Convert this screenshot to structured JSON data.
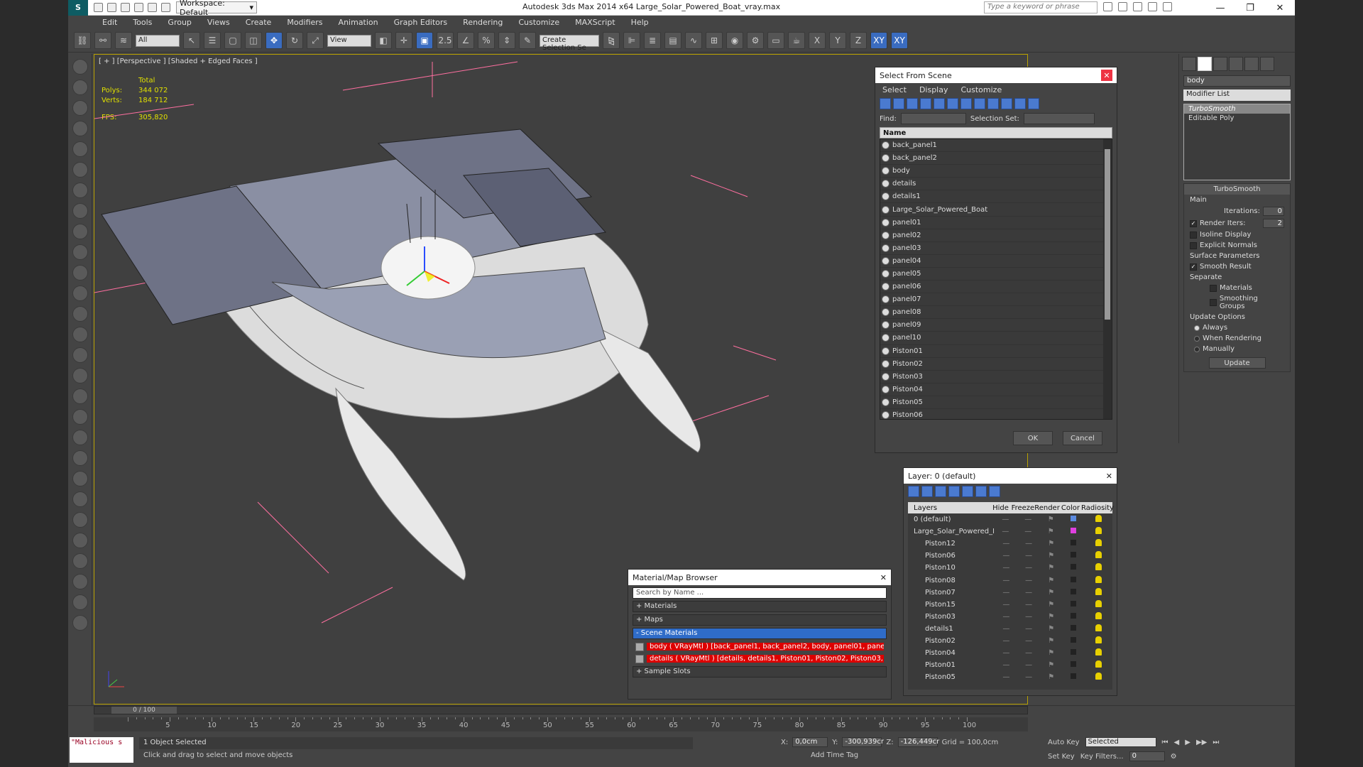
{
  "titlebar": {
    "workspace": "Workspace: Default",
    "title": "Autodesk 3ds Max  2014 x64      Large_Solar_Powered_Boat_vray.max",
    "search_placeholder": "Type a keyword or phrase"
  },
  "menu": [
    "Edit",
    "Tools",
    "Group",
    "Views",
    "Create",
    "Modifiers",
    "Animation",
    "Graph Editors",
    "Rendering",
    "Customize",
    "MAXScript",
    "Help"
  ],
  "toolbar": {
    "filter": "All",
    "ref_coord": "View",
    "selection_set": "Create Selection Se"
  },
  "viewport": {
    "label": "[ + ] [Perspective ] [Shaded + Edged Faces ]",
    "stats": {
      "total": "Total",
      "polys_label": "Polys:",
      "polys": "344 072",
      "verts_label": "Verts:",
      "verts": "184 712",
      "fps_label": "FPS:",
      "fps": "305,820"
    }
  },
  "select_from_scene": {
    "title": "Select From Scene",
    "menu": [
      "Select",
      "Display",
      "Customize"
    ],
    "find_label": "Find:",
    "selection_set_label": "Selection Set:",
    "column_name": "Name",
    "items": [
      "back_panel1",
      "back_panel2",
      "body",
      "details",
      "details1",
      "Large_Solar_Powered_Boat",
      "panel01",
      "panel02",
      "panel03",
      "panel04",
      "panel05",
      "panel06",
      "panel07",
      "panel08",
      "panel09",
      "panel10",
      "Piston01",
      "Piston02",
      "Piston03",
      "Piston04",
      "Piston05",
      "Piston06"
    ],
    "ok": "OK",
    "cancel": "Cancel"
  },
  "command_panel": {
    "name_field": "body",
    "modifier_list": "Modifier List",
    "stack": [
      "TurboSmooth",
      "Editable Poly"
    ],
    "rollout_title": "TurboSmooth",
    "main": "Main",
    "iterations_label": "Iterations:",
    "iterations": "0",
    "render_iters_label": "Render Iters:",
    "render_iters": "2",
    "isoline": "Isoline Display",
    "explicit_normals": "Explicit Normals",
    "surface_params": "Surface Parameters",
    "smooth_result": "Smooth Result",
    "separate": "Separate",
    "materials": "Materials",
    "smoothing_groups": "Smoothing Groups",
    "update_options": "Update Options",
    "always": "Always",
    "when_rendering": "When Rendering",
    "manually": "Manually",
    "update": "Update"
  },
  "layer_dialog": {
    "title": "Layer: 0 (default)",
    "headers": [
      "Layers",
      "Hide",
      "Freeze",
      "Render",
      "Color",
      "Radiosity"
    ],
    "rows": [
      {
        "name": "0 (default)",
        "color": "#5a8ae0"
      },
      {
        "name": "Large_Solar_Powered_E",
        "color": "#e040e0"
      },
      {
        "name": "Piston12",
        "color": "#222222"
      },
      {
        "name": "Piston06",
        "color": "#222222"
      },
      {
        "name": "Piston10",
        "color": "#222222"
      },
      {
        "name": "Piston08",
        "color": "#222222"
      },
      {
        "name": "Piston07",
        "color": "#222222"
      },
      {
        "name": "Piston15",
        "color": "#222222"
      },
      {
        "name": "Piston03",
        "color": "#222222"
      },
      {
        "name": "details1",
        "color": "#222222"
      },
      {
        "name": "Piston02",
        "color": "#222222"
      },
      {
        "name": "Piston04",
        "color": "#222222"
      },
      {
        "name": "Piston01",
        "color": "#222222"
      },
      {
        "name": "Piston05",
        "color": "#222222"
      }
    ]
  },
  "material_browser": {
    "title": "Material/Map Browser",
    "search_placeholder": "Search by Name ...",
    "sections": [
      "+ Materials",
      "+ Maps",
      "- Scene Materials"
    ],
    "materials": [
      "body  ( VRayMtl ) [back_panel1, back_panel2, body, panel01, panel...",
      "details  ( VRayMtl ) [details, details1, Piston01, Piston02, Piston03,..."
    ],
    "sample_slots": "+ Sample Slots"
  },
  "timeline": {
    "position": "0 / 100",
    "ticks": [
      5,
      10,
      15,
      20,
      25,
      30,
      35,
      40,
      45,
      50,
      55,
      60,
      65,
      70,
      75,
      80,
      85,
      90,
      95,
      100
    ]
  },
  "status": {
    "selected": "1 Object Selected",
    "prompt": "Click and drag to select and move objects",
    "maxscript": "\"Malicious s",
    "x": "0,0cm",
    "y": "-300,939cr",
    "z": "-126,449cr",
    "grid": "Grid = 100,0cm",
    "auto_key": "Auto Key",
    "set_key": "Set Key",
    "key_mode": "Selected",
    "key_filters": "Key Filters...",
    "add_time_tag": "Add Time Tag",
    "frame": "0"
  }
}
